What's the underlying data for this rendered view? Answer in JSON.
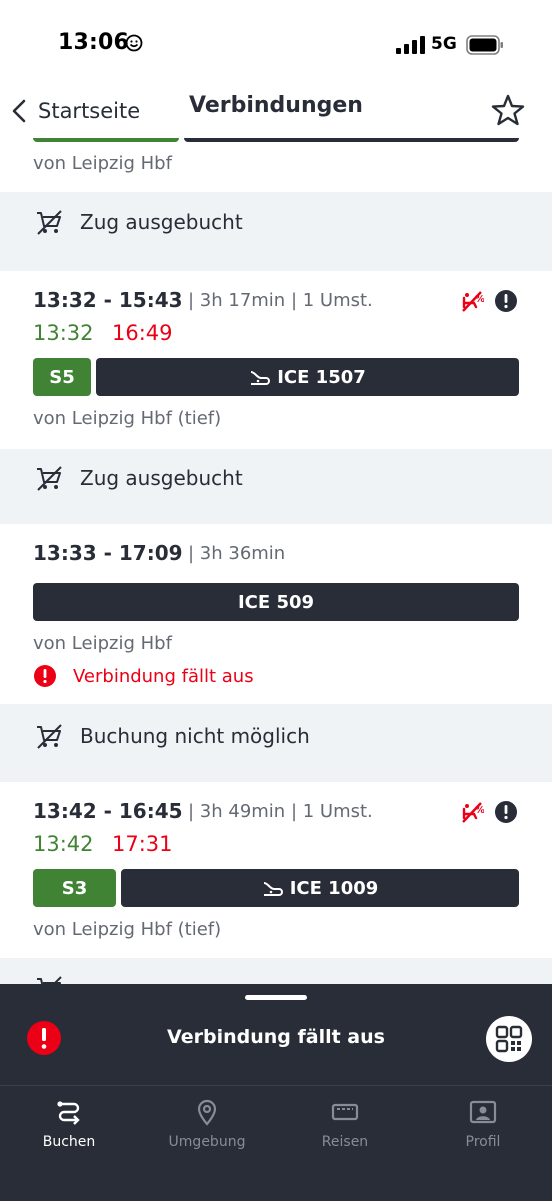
{
  "status_bar": {
    "time": "13:06",
    "network": "5G"
  },
  "nav": {
    "back_label": "Startseite",
    "title": "Verbindungen"
  },
  "connections": [
    {
      "from": "von Leipzig Hbf",
      "notice": "Zug ausgebucht"
    },
    {
      "times": "13:32 - 15:43",
      "meta": "| 3h 17min | 1 Umst.",
      "rt_dep": "13:32",
      "rt_arr": "16:49",
      "segments": [
        {
          "label": "S5"
        },
        {
          "label": "ICE 1507"
        }
      ],
      "from": "von Leipzig Hbf (tief)",
      "notice": "Zug ausgebucht"
    },
    {
      "times": "13:33 - 17:09",
      "meta": "| 3h 36min",
      "segments": [
        {
          "label": "ICE 509"
        }
      ],
      "from": "von Leipzig Hbf",
      "status": "Verbindung fällt aus",
      "notice": "Buchung nicht möglich"
    },
    {
      "times": "13:42 - 16:45",
      "meta": "| 3h 49min | 1 Umst.",
      "rt_dep": "13:42",
      "rt_arr": "17:31",
      "segments": [
        {
          "label": "S3"
        },
        {
          "label": "ICE 1009"
        }
      ],
      "from": "von Leipzig Hbf (tief)"
    }
  ],
  "sheet": {
    "message": "Verbindung fällt aus"
  },
  "tabs": [
    {
      "label": "Buchen",
      "active": true
    },
    {
      "label": "Umgebung",
      "active": false
    },
    {
      "label": "Reisen",
      "active": false
    },
    {
      "label": "Profil",
      "active": false
    }
  ],
  "colors": {
    "dark": "#282d37",
    "green": "#408335",
    "red": "#ec0016",
    "muted": "#646973",
    "background": "#f0f3f5"
  },
  "icons": [
    "smiley-icon",
    "signal-icon",
    "battery-icon",
    "back-chevron-icon",
    "star-icon",
    "no-cart-icon",
    "ice-train-icon",
    "no-seat-icon",
    "alert-icon",
    "qr-code-icon",
    "route-icon",
    "location-pin-icon",
    "ticket-icon",
    "profile-icon"
  ]
}
